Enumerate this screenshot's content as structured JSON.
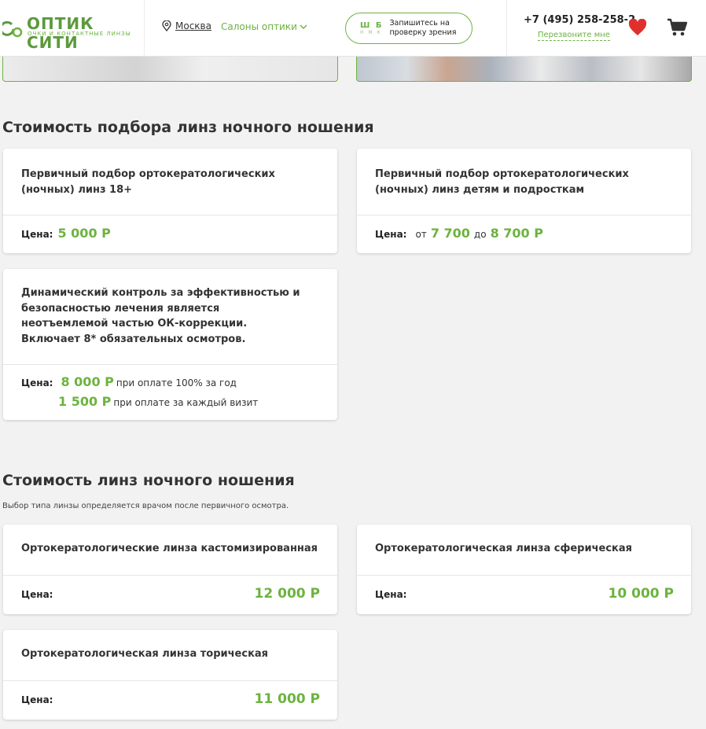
{
  "header": {
    "logo_name": "ОПТИК СИТИ",
    "logo_sub": "очки и контактные линзы",
    "city": "Москва",
    "salons": "Салоны оптики",
    "eye_chart_top": "Ш Б",
    "eye_chart_bottom": "Н М К",
    "book_label": "Запишитесь на проверку зрения",
    "phone": "+7 (495) 258-258-2",
    "callback": "Перезвоните мне",
    "icons": [
      "location-pin-icon",
      "chevron-down-icon",
      "heart-icon",
      "cart-icon"
    ],
    "accent_color": "#6cb33f",
    "heart_color": "#e0302e"
  },
  "section1": {
    "title": "Стоимость подбора линз ночного ношения",
    "cards": [
      {
        "title": "Первичный подбор ортокератологических (ночных) линз 18+",
        "price_label": "Цена:",
        "price": "5 000 Р"
      },
      {
        "title": "Первичный подбор ортокератологических (ночных) линз детям и подросткам",
        "price_label": "Цена:",
        "from": "от",
        "price_from": "7 700",
        "to": "до",
        "price_to": "8 700 Р"
      },
      {
        "title": "Динамический контроль за эффективностью и безопасностью лечения является неотъемлемой частью ОК-коррекции. Включает 8* обязательных осмотров.",
        "price_label": "Цена:",
        "price_year": "8 000 Р",
        "note_year": "при оплате 100% за год",
        "price_visit": "1 500 Р",
        "note_visit": "при оплате за каждый визит"
      }
    ]
  },
  "section2": {
    "title": "Стоимость линз ночного ношения",
    "note": "Выбор типа линзы определяется врачом после первичного осмотра.",
    "cards": [
      {
        "title": "Ортокератологические линза кастомизированная",
        "price_label": "Цена:",
        "price": "12 000 Р"
      },
      {
        "title": "Ортокератологическая линза сферическая",
        "price_label": "Цена:",
        "price": "10 000 Р"
      },
      {
        "title": "Ортокератологическая линза торическая",
        "price_label": "Цена:",
        "price": "11 000 Р"
      }
    ]
  }
}
